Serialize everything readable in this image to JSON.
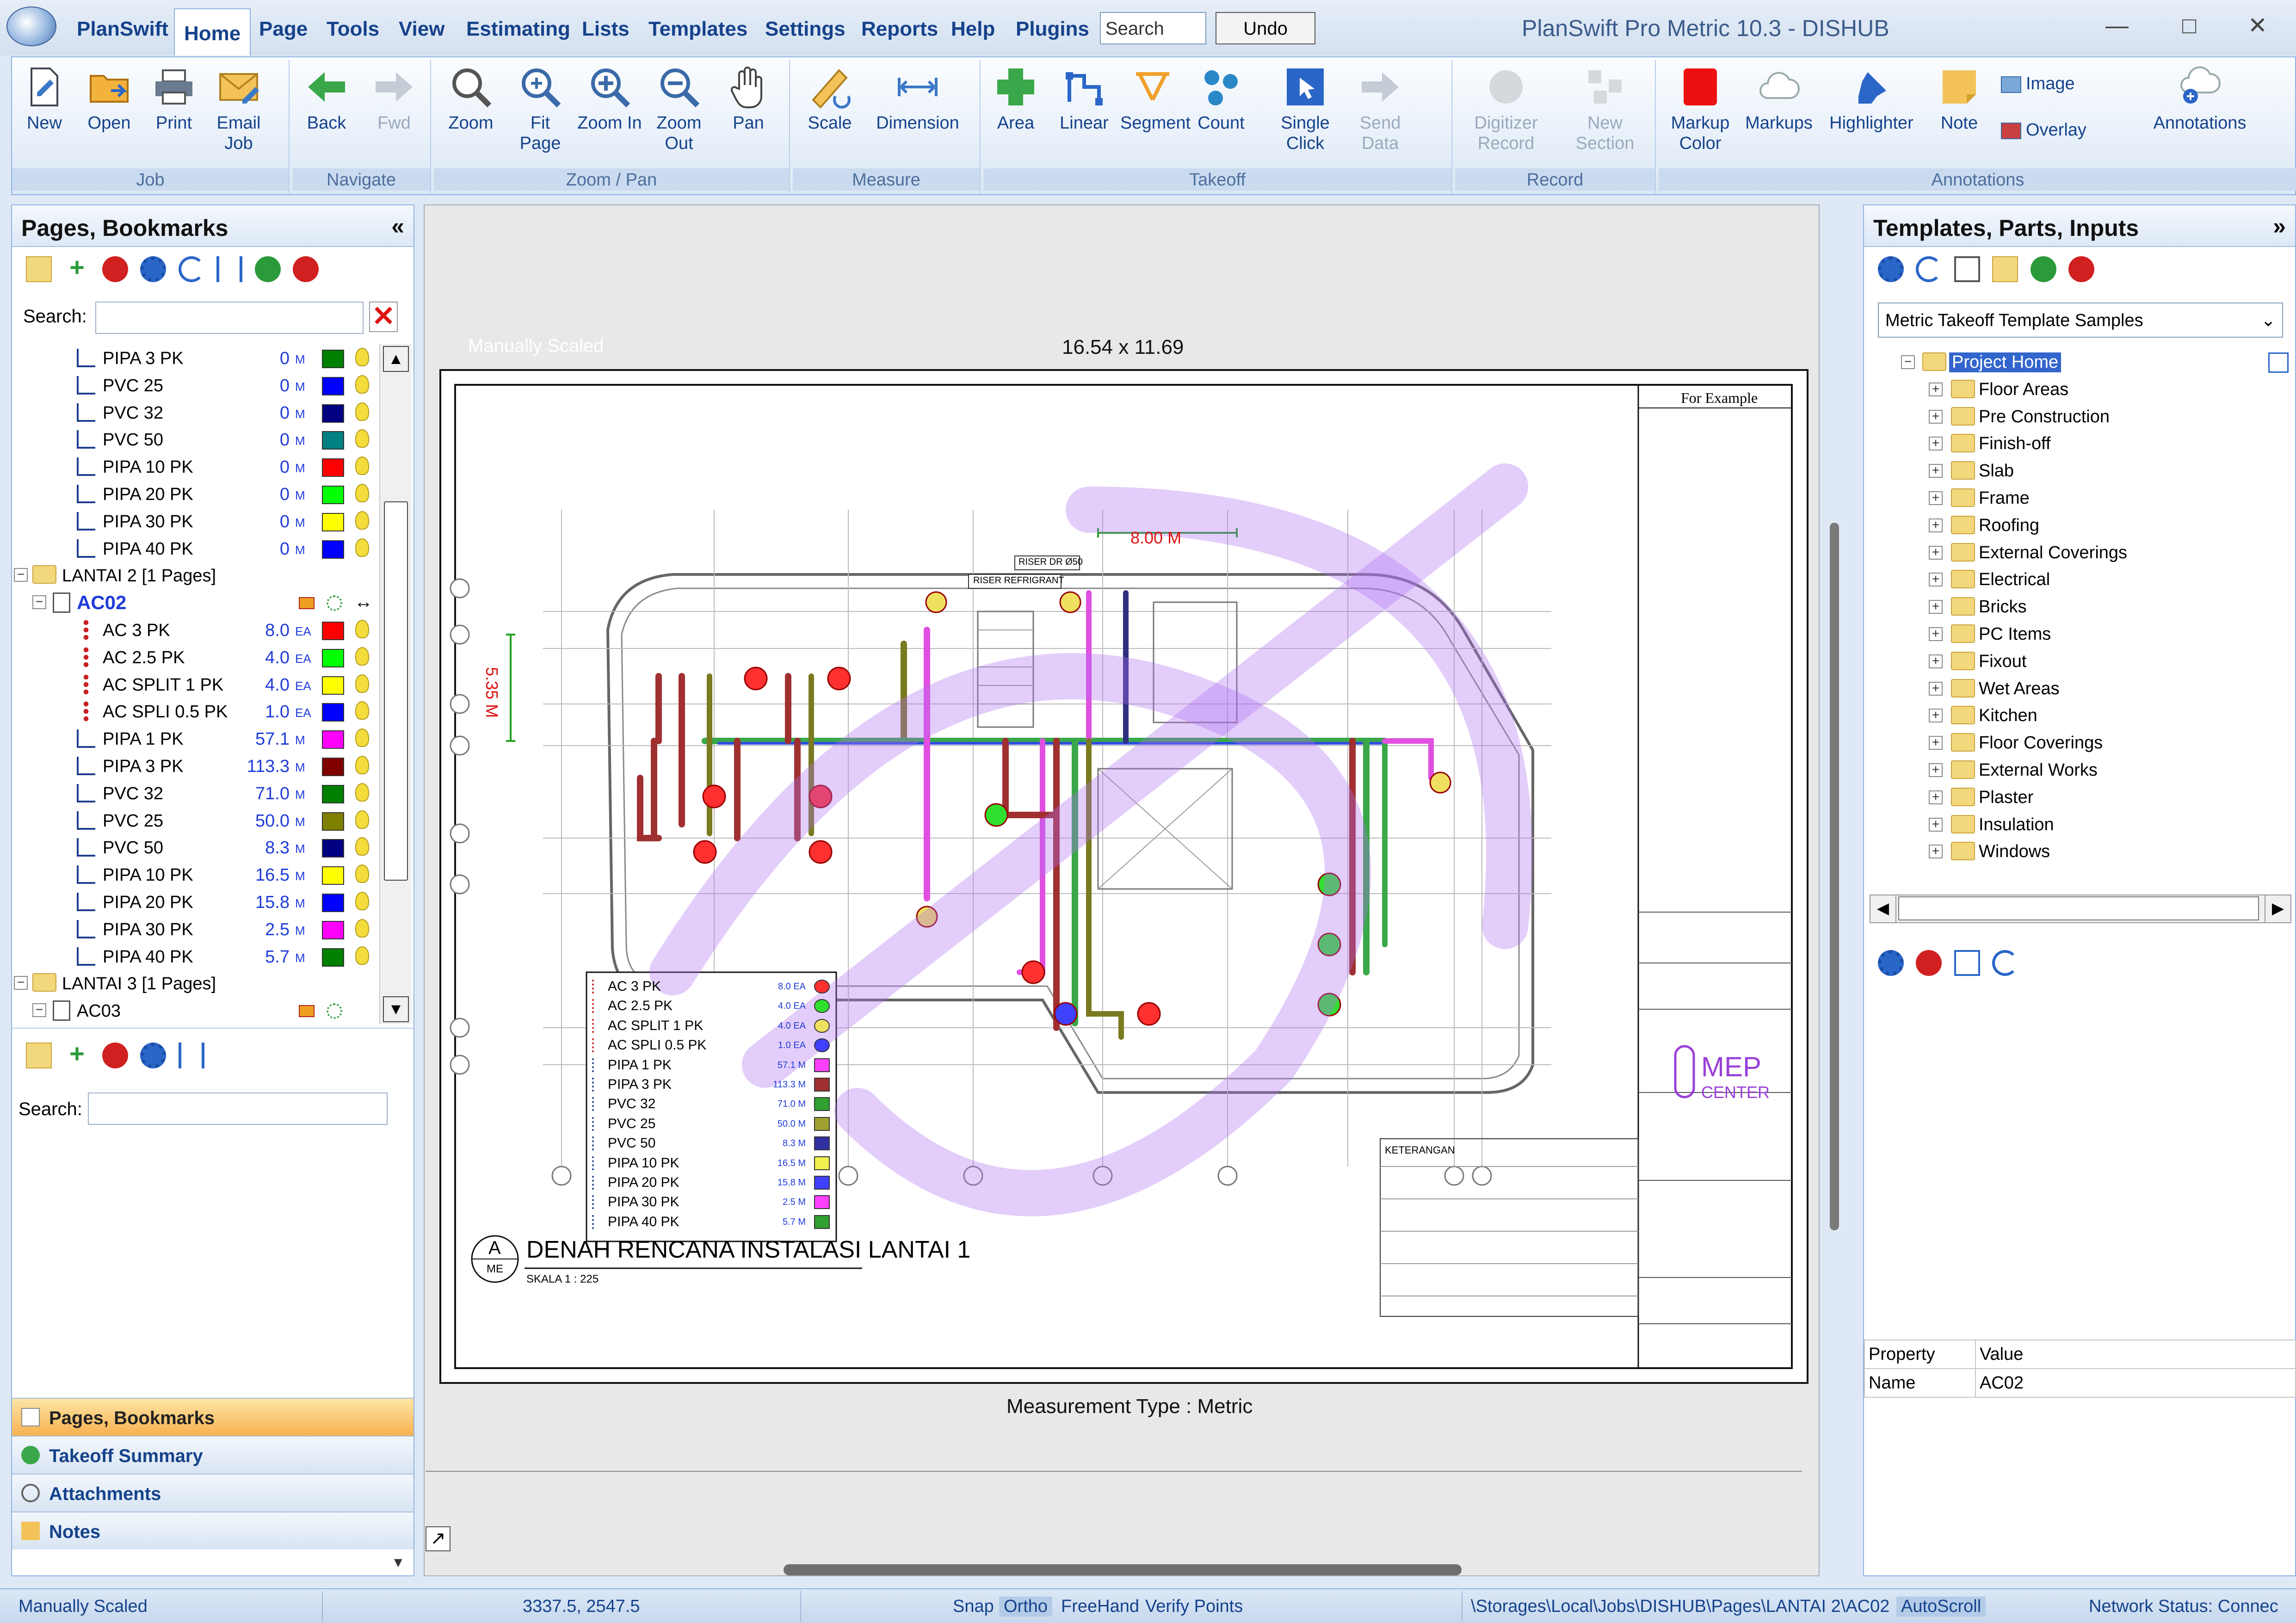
{
  "app": {
    "button_label": "PlanSwift",
    "window_title": "PlanSwift Pro Metric 10.3 - DISHUB",
    "search_placeholder": "Search",
    "undo_label": "Undo"
  },
  "menu": [
    "Home",
    "Page",
    "Tools",
    "View",
    "Estimating",
    "Lists",
    "Templates",
    "Settings",
    "Reports",
    "Help",
    "Plugins"
  ],
  "ribbon": {
    "job": {
      "label": "Job",
      "buttons": [
        "New",
        "Open",
        "Print",
        "Email Job"
      ]
    },
    "navigate": {
      "label": "Navigate",
      "buttons": [
        "Back",
        "Fwd"
      ]
    },
    "zoom": {
      "label": "Zoom / Pan",
      "buttons": [
        "Zoom",
        "Fit Page",
        "Zoom In",
        "Zoom Out",
        "Pan"
      ]
    },
    "measure": {
      "label": "Measure",
      "buttons": [
        "Scale",
        "Dimension"
      ]
    },
    "takeoff": {
      "label": "Takeoff",
      "buttons": [
        "Area",
        "Linear",
        "Segment",
        "Count",
        "Single Click",
        "Send Data"
      ]
    },
    "record": {
      "label": "Record",
      "buttons": [
        "Digitizer Record",
        "New Section"
      ]
    },
    "annotations": {
      "label": "Annotations",
      "buttons": [
        "Markup Color",
        "Markups",
        "Highlighter",
        "Note",
        "Image",
        "Overlay",
        "Annotations"
      ]
    }
  },
  "left_panel": {
    "title": "Pages, Bookmarks",
    "search_label": "Search:",
    "search_value": "",
    "tree": [
      {
        "type": "pipe",
        "indent": 1,
        "label": "PIPA 3 PK",
        "qty": "0",
        "unit": "M",
        "color": "#008000"
      },
      {
        "type": "pipe",
        "indent": 1,
        "label": "PVC 25",
        "qty": "0",
        "unit": "M",
        "color": "#0000ff"
      },
      {
        "type": "pipe",
        "indent": 1,
        "label": "PVC 32",
        "qty": "0",
        "unit": "M",
        "color": "#000080"
      },
      {
        "type": "pipe",
        "indent": 1,
        "label": "PVC 50",
        "qty": "0",
        "unit": "M",
        "color": "#008080"
      },
      {
        "type": "pipe",
        "indent": 1,
        "label": "PIPA 10 PK",
        "qty": "0",
        "unit": "M",
        "color": "#ff0000"
      },
      {
        "type": "pipe",
        "indent": 1,
        "label": "PIPA 20 PK",
        "qty": "0",
        "unit": "M",
        "color": "#00ff00"
      },
      {
        "type": "pipe",
        "indent": 1,
        "label": "PIPA 30 PK",
        "qty": "0",
        "unit": "M",
        "color": "#ffff00"
      },
      {
        "type": "pipe",
        "indent": 1,
        "label": "PIPA 40 PK",
        "qty": "0",
        "unit": "M",
        "color": "#0000ff"
      },
      {
        "type": "folder",
        "indent": 0,
        "label": "LANTAI 2 [1 Pages]"
      },
      {
        "type": "page",
        "indent": 0,
        "label": "AC02"
      },
      {
        "type": "ac",
        "indent": 1,
        "label": "AC 3 PK",
        "qty": "8.0",
        "unit": "EA",
        "color": "#ff0000"
      },
      {
        "type": "ac",
        "indent": 1,
        "label": "AC 2.5 PK",
        "qty": "4.0",
        "unit": "EA",
        "color": "#00ff00"
      },
      {
        "type": "ac",
        "indent": 1,
        "label": "AC SPLIT 1 PK",
        "qty": "4.0",
        "unit": "EA",
        "color": "#ffff00"
      },
      {
        "type": "ac",
        "indent": 1,
        "label": "AC SPLI 0.5 PK",
        "qty": "1.0",
        "unit": "EA",
        "color": "#0000ff"
      },
      {
        "type": "pipe",
        "indent": 1,
        "label": "PIPA 1 PK",
        "qty": "57.1",
        "unit": "M",
        "color": "#ff00ff"
      },
      {
        "type": "pipe",
        "indent": 1,
        "label": "PIPA 3 PK",
        "qty": "113.3",
        "unit": "M",
        "color": "#800000"
      },
      {
        "type": "pipe",
        "indent": 1,
        "label": "PVC  32",
        "qty": "71.0",
        "unit": "M",
        "color": "#008000"
      },
      {
        "type": "pipe",
        "indent": 1,
        "label": "PVC 25",
        "qty": "50.0",
        "unit": "M",
        "color": "#808000"
      },
      {
        "type": "pipe",
        "indent": 1,
        "label": "PVC 50",
        "qty": "8.3",
        "unit": "M",
        "color": "#000080"
      },
      {
        "type": "pipe",
        "indent": 1,
        "label": "PIPA 10 PK",
        "qty": "16.5",
        "unit": "M",
        "color": "#ffff00"
      },
      {
        "type": "pipe",
        "indent": 1,
        "label": "PIPA 20 PK",
        "qty": "15.8",
        "unit": "M",
        "color": "#0000ff"
      },
      {
        "type": "pipe",
        "indent": 1,
        "label": "PIPA 30 PK",
        "qty": "2.5",
        "unit": "M",
        "color": "#ff00ff"
      },
      {
        "type": "pipe",
        "indent": 1,
        "label": "PIPA 40 PK",
        "qty": "5.7",
        "unit": "M",
        "color": "#008000"
      },
      {
        "type": "folder",
        "indent": 0,
        "label": "LANTAI 3 [1 Pages]"
      },
      {
        "type": "page",
        "indent": 0,
        "label": "AC03"
      }
    ],
    "lower_search_label": "Search:",
    "nav_tabs": [
      "Pages, Bookmarks",
      "Takeoff Summary",
      "Attachments",
      "Notes"
    ]
  },
  "canvas": {
    "manually_scaled": "Manually Scaled",
    "sheet_size": "16.54 x 11.69",
    "measurement_type": "Measurement Type : Metric",
    "plan_title": "DENAH RENCANA INSTALASI  LANTAI 1",
    "plan_scale": "SKALA   1 : 225",
    "plan_tag_top": "A",
    "plan_tag_bottom": "ME",
    "dim_horizontal": "8.00 M",
    "dim_vertical": "5.35 M",
    "title_block_example": "For  Example",
    "logo_text_1": "MEP",
    "logo_text_2": "CENTER",
    "keterangan": "KETERANGAN",
    "riser_1": "RISER DR Ø50",
    "riser_2": "RISER REFRIGRANT",
    "legend": [
      {
        "label": "AC 3 PK",
        "qty": "8.0 EA",
        "color": "#ff3030"
      },
      {
        "label": "AC 2.5 PK",
        "qty": "4.0 EA",
        "color": "#30e030"
      },
      {
        "label": "AC SPLIT 1 PK",
        "qty": "4.0 EA",
        "color": "#f0e060"
      },
      {
        "label": "AC SPLI 0.5 PK",
        "qty": "1.0 EA",
        "color": "#4040ff"
      },
      {
        "label": "PIPA 1 PK",
        "qty": "57.1 M",
        "color": "#ff40ff"
      },
      {
        "label": "PIPA 3 PK",
        "qty": "113.3 M",
        "color": "#a03030"
      },
      {
        "label": "PVC  32",
        "qty": "71.0 M",
        "color": "#30a030"
      },
      {
        "label": "PVC 25",
        "qty": "50.0 M",
        "color": "#a0a030"
      },
      {
        "label": "PVC 50",
        "qty": "8.3 M",
        "color": "#3030a0"
      },
      {
        "label": "PIPA 10 PK",
        "qty": "16.5 M",
        "color": "#f0f050"
      },
      {
        "label": "PIPA 20 PK",
        "qty": "15.8 M",
        "color": "#4040ff"
      },
      {
        "label": "PIPA 30 PK",
        "qty": "2.5 M",
        "color": "#ff40ff"
      },
      {
        "label": "PIPA 40 PK",
        "qty": "5.7 M",
        "color": "#30a030"
      }
    ]
  },
  "right_panel": {
    "title": "Templates, Parts, Inputs",
    "template_select": "Metric Takeoff Template Samples",
    "root": "Project Home",
    "folders": [
      "Floor Areas",
      "Pre Construction",
      "Finish-off",
      "Slab",
      "Frame",
      "Roofing",
      "External Coverings",
      "Electrical",
      "Bricks",
      "PC Items",
      "Fixout",
      "Wet Areas",
      "Kitchen",
      "Floor Coverings",
      "External Works",
      "Plaster",
      "Insulation",
      "Windows"
    ],
    "property_header": {
      "col1": "Property",
      "col2": "Value"
    },
    "property_rows": [
      {
        "name": "Name",
        "value": "AC02"
      }
    ]
  },
  "statusbar": {
    "scale": "Manually Scaled",
    "coords": "3337.5, 2547.5",
    "snap": "Snap",
    "ortho": "Ortho",
    "freehand": "FreeHand",
    "verify": "Verify Points",
    "path": "\\Storages\\Local\\Jobs\\DISHUB\\Pages\\LANTAI 2\\AC02",
    "autoscroll": "AutoScroll",
    "network": "Network Status: Connec"
  }
}
